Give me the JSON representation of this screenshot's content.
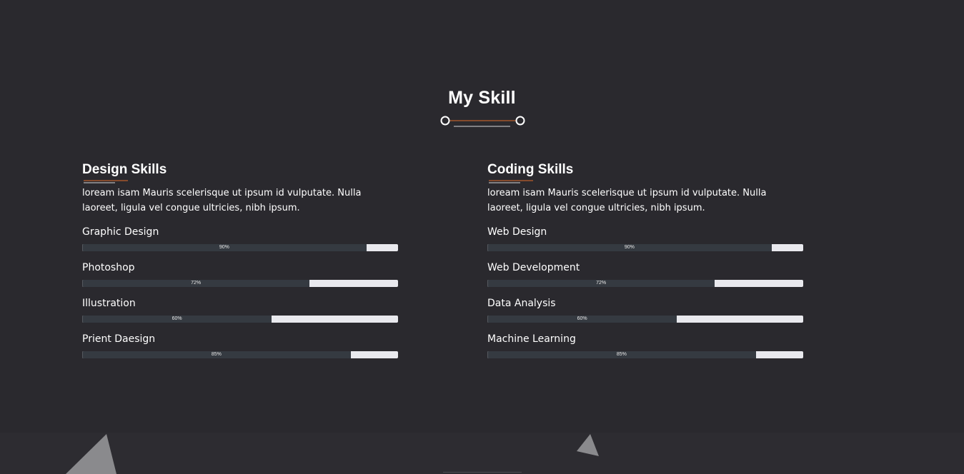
{
  "section": {
    "title": "My Skill"
  },
  "design": {
    "title": "Design Skills",
    "description": "loream isam Mauris scelerisque ut ipsum id vulputate. Nulla laoreet, ligula vel congue ultricies, nibh ipsum.",
    "skills": [
      {
        "name": "Graphic Design",
        "percent_label": "90%",
        "percent": 90
      },
      {
        "name": "Photoshop",
        "percent_label": "72%",
        "percent": 72
      },
      {
        "name": "Illustration",
        "percent_label": "60%",
        "percent": 60
      },
      {
        "name": "Prient Daesign",
        "percent_label": "85%",
        "percent": 85
      }
    ]
  },
  "coding": {
    "title": "Coding Skills",
    "description": "loream isam Mauris scelerisque ut ipsum id vulputate. Nulla laoreet, ligula vel congue ultricies, nibh ipsum.",
    "skills": [
      {
        "name": "Web Design",
        "percent_label": "90%",
        "percent": 90
      },
      {
        "name": "Web Development",
        "percent_label": "72%",
        "percent": 72
      },
      {
        "name": "Data Analysis",
        "percent_label": "60%",
        "percent": 60
      },
      {
        "name": "Machine Learning",
        "percent_label": "85%",
        "percent": 85
      }
    ]
  },
  "colors": {
    "background": "#2a292e",
    "accent": "#e06b2a",
    "bar_track": "#e9e9ee",
    "bar_fill": "#353a41",
    "triangle": "#8a8a8d"
  }
}
